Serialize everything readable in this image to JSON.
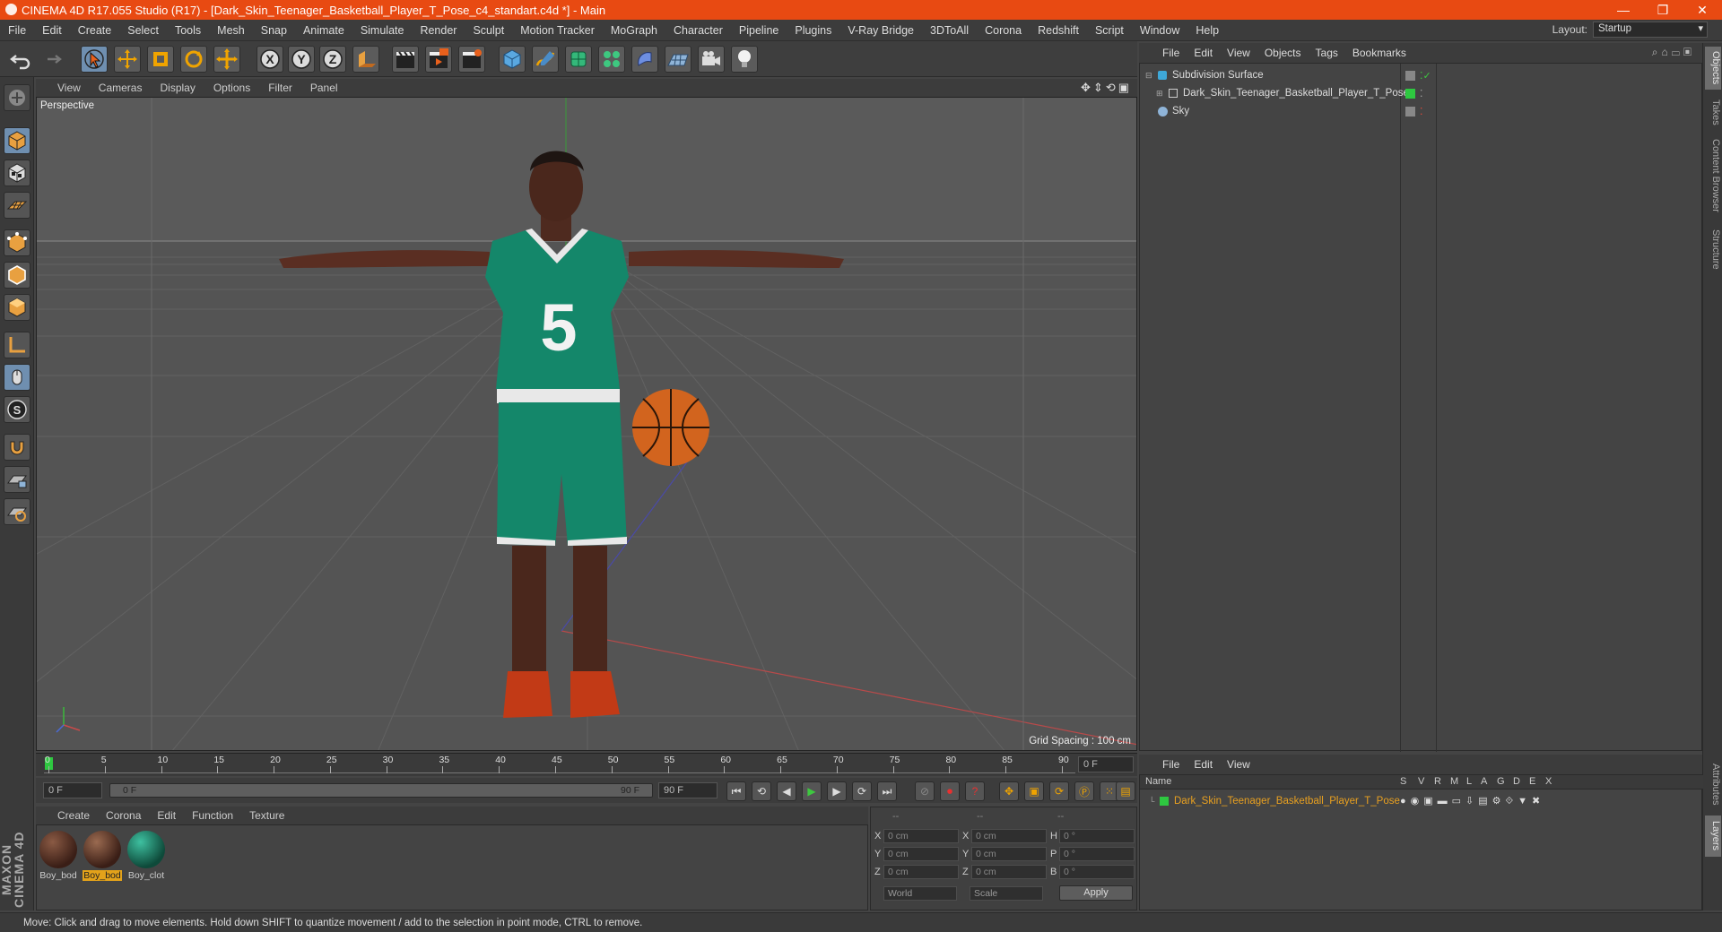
{
  "window": {
    "title": "CINEMA 4D R17.055 Studio (R17) - [Dark_Skin_Teenager_Basketball_Player_T_Pose_c4_standart.c4d *] - Main",
    "controls": [
      "—",
      "❐",
      "✕"
    ]
  },
  "menubar": {
    "items": [
      "File",
      "Edit",
      "Create",
      "Select",
      "Tools",
      "Mesh",
      "Snap",
      "Animate",
      "Simulate",
      "Render",
      "Sculpt",
      "Motion Tracker",
      "MoGraph",
      "Character",
      "Pipeline",
      "Plugins",
      "V-Ray Bridge",
      "3DToAll",
      "Corona",
      "Redshift",
      "Script",
      "Window",
      "Help"
    ],
    "layout_label": "Layout:",
    "layout_value": "Startup"
  },
  "viewport": {
    "menu": [
      "View",
      "Cameras",
      "Display",
      "Options",
      "Filter",
      "Panel"
    ],
    "label": "Perspective",
    "grid_spacing": "Grid Spacing : 100 cm",
    "jersey_number": "5"
  },
  "timeline": {
    "ticks": [
      "0",
      "5",
      "10",
      "15",
      "20",
      "25",
      "30",
      "35",
      "40",
      "45",
      "50",
      "55",
      "60",
      "65",
      "70",
      "75",
      "80",
      "85",
      "90"
    ],
    "current_frame": "0 F",
    "start_field": "0 F",
    "range_start": "0 F",
    "range_end": "90 F",
    "end_field": "90 F"
  },
  "materials": {
    "menu": [
      "Create",
      "Corona",
      "Edit",
      "Function",
      "Texture"
    ],
    "items": [
      {
        "label": "Boy_bod",
        "color": "#4a2a20"
      },
      {
        "label": "Boy_bod",
        "color": "#5a3020"
      },
      {
        "label": "Boy_clot",
        "color": "#1b7d62"
      }
    ]
  },
  "coords": {
    "headers": [
      "--",
      "--",
      "--"
    ],
    "rows": [
      {
        "l1": "X",
        "v1": "0 cm",
        "l2": "X",
        "v2": "0 cm",
        "l3": "H",
        "v3": "0 °"
      },
      {
        "l1": "Y",
        "v1": "0 cm",
        "l2": "Y",
        "v2": "0 cm",
        "l3": "P",
        "v3": "0 °"
      },
      {
        "l1": "Z",
        "v1": "0 cm",
        "l2": "Z",
        "v2": "0 cm",
        "l3": "B",
        "v3": "0 °"
      }
    ],
    "world": "World",
    "scale": "Scale",
    "apply": "Apply"
  },
  "objects": {
    "menu": [
      "File",
      "Edit",
      "View",
      "Objects",
      "Tags",
      "Bookmarks"
    ],
    "items": [
      {
        "name": "Subdivision Surface",
        "color": "#3ea8d8"
      },
      {
        "name": "Dark_Skin_Teenager_Basketball_Player_T_Pose",
        "color": "#cccccc"
      },
      {
        "name": "Sky",
        "color": "#8fb4d8"
      }
    ]
  },
  "layers": {
    "menu": [
      "File",
      "Edit",
      "View"
    ],
    "header_name": "Name",
    "header_cols": [
      "S",
      "V",
      "R",
      "M",
      "L",
      "A",
      "G",
      "D",
      "E",
      "X"
    ],
    "item": "Dark_Skin_Teenager_Basketball_Player_T_Pose"
  },
  "right_tabs": [
    "Objects",
    "Takes",
    "Content Browser",
    "Structure",
    "Attributes",
    "Layers"
  ],
  "status": "Move: Click and drag to move elements. Hold down SHIFT to quantize movement / add to the selection in point mode, CTRL to remove.",
  "branding": "MAXON CINEMA 4D"
}
